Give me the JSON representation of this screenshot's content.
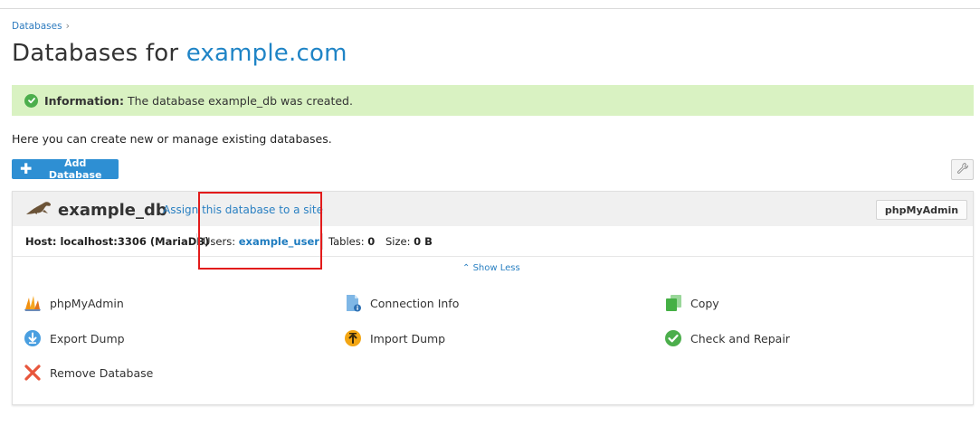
{
  "breadcrumb": {
    "label": "Databases",
    "separator": "›"
  },
  "page": {
    "title_prefix": "Databases for ",
    "title_domain": "example.com"
  },
  "info": {
    "label": "Information:",
    "message": "The database example_db was created."
  },
  "intro": "Here you can create new or manage existing databases.",
  "toolbar": {
    "add_label": "Add Database",
    "wrench_icon": "wrench-icon"
  },
  "database": {
    "name": "example_db",
    "assign_link": "Assign this database to a site",
    "phpmyadmin_button": "phpMyAdmin",
    "host_label": "Host: localhost:3306 (MariaDB)",
    "users_label": "Users: ",
    "users_value": "example_user",
    "tables_label": "Tables: ",
    "tables_value": "0",
    "size_label": "Size: ",
    "size_value": "0 B",
    "show_less": "Show Less",
    "actions": [
      {
        "label": "phpMyAdmin",
        "icon": "phpmyadmin-icon"
      },
      {
        "label": "Connection Info",
        "icon": "connection-info-icon"
      },
      {
        "label": "Copy",
        "icon": "copy-icon"
      },
      {
        "label": "Export Dump",
        "icon": "export-icon"
      },
      {
        "label": "Import Dump",
        "icon": "import-icon"
      },
      {
        "label": "Check and Repair",
        "icon": "check-icon"
      },
      {
        "label": "Remove Database",
        "icon": "remove-icon"
      }
    ]
  },
  "colors": {
    "accent": "#1f84c6",
    "success_bg": "#d9f2c2",
    "button_blue": "#2e8fd3",
    "highlight": "#e21b1b"
  }
}
